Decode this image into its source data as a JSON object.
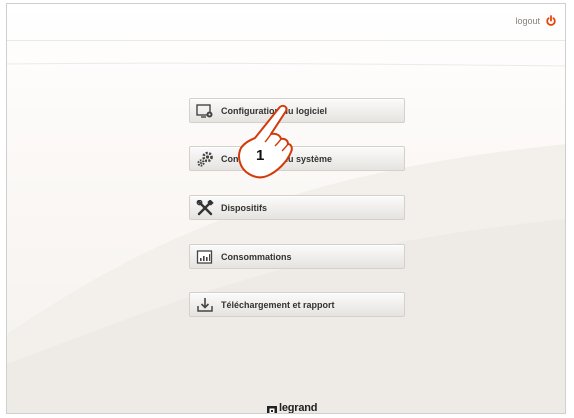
{
  "header": {
    "logout_label": "logout",
    "logout_icon": "power-icon"
  },
  "menu": {
    "items": [
      {
        "label": "Configuration du logiciel",
        "icon": "monitor-settings-icon"
      },
      {
        "label": "Configuration du système",
        "icon": "gears-icon"
      },
      {
        "label": "Dispositifs",
        "icon": "tools-icon"
      },
      {
        "label": "Consommations",
        "icon": "chart-icon"
      },
      {
        "label": "Téléchargement et rapport",
        "icon": "download-icon"
      }
    ]
  },
  "callout": {
    "number": "1",
    "icon": "pointing-hand-icon"
  },
  "footer": {
    "brand": "legrand",
    "brand_icon": "legrand-logo-icon"
  },
  "colors": {
    "accent": "#e8450a",
    "button_text": "#333333"
  }
}
